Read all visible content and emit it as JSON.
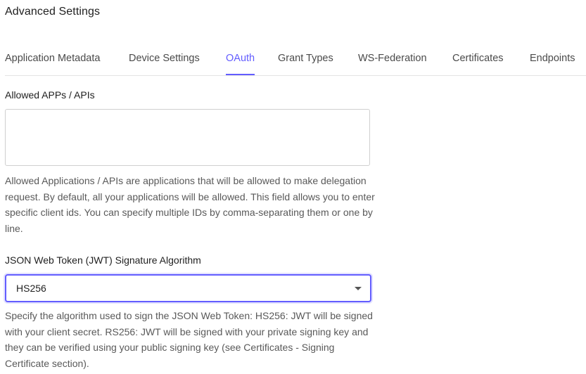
{
  "header": {
    "title": "Advanced Settings"
  },
  "tabs": [
    {
      "label": "Application Metadata",
      "active": false
    },
    {
      "label": "Device Settings",
      "active": false
    },
    {
      "label": "OAuth",
      "active": true
    },
    {
      "label": "Grant Types",
      "active": false
    },
    {
      "label": "WS-Federation",
      "active": false
    },
    {
      "label": "Certificates",
      "active": false
    },
    {
      "label": "Endpoints",
      "active": false
    }
  ],
  "allowed_apps": {
    "label": "Allowed APPs / APIs",
    "value": "",
    "help": "Allowed Applications / APIs are applications that will be allowed to make delegation request. By default, all your applications will be allowed. This field allows you to enter specific client ids. You can specify multiple IDs by comma-separating them or one by line."
  },
  "jwt_algorithm": {
    "label": "JSON Web Token (JWT) Signature Algorithm",
    "selected": "HS256",
    "help": "Specify the algorithm used to sign the JSON Web Token: HS256: JWT will be signed with your client secret. RS256: JWT will be signed with your private signing key and they can be verified using your public signing key (see Certificates - Signing Certificate section)."
  },
  "colors": {
    "accent": "#635dff",
    "text": "#1f1f1f",
    "muted": "#595959",
    "border": "#cfcfcf"
  }
}
